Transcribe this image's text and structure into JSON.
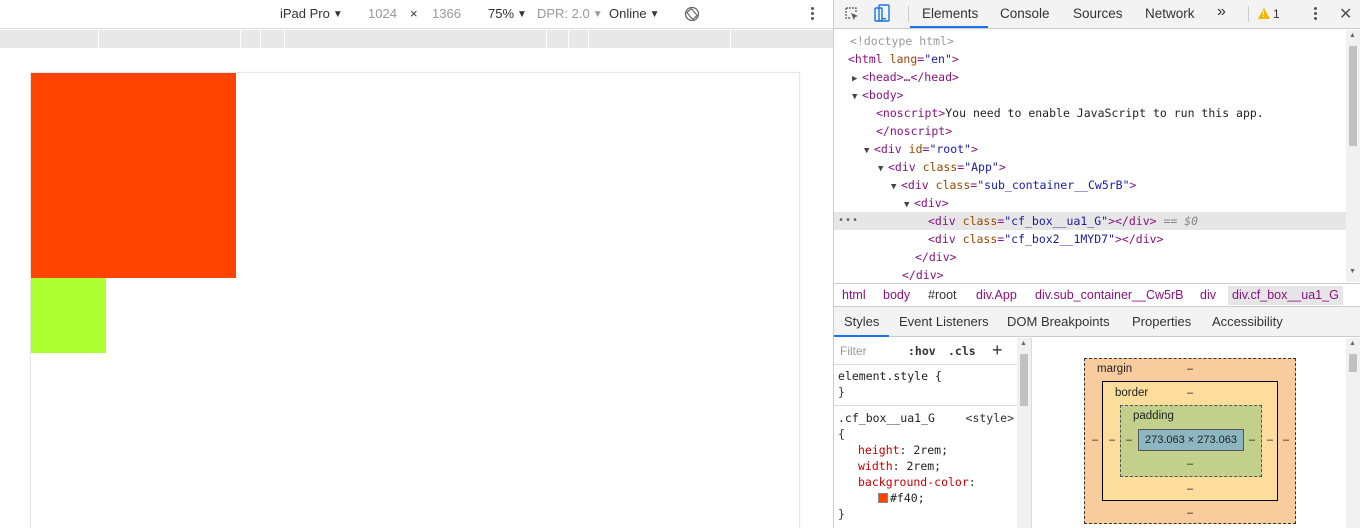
{
  "device_toolbar": {
    "device": "iPad Pro",
    "width": "1024",
    "times": "×",
    "height": "1366",
    "zoom": "75%",
    "dpr": "DPR: 2.0",
    "network": "Online",
    "rotate_icon": "rotate-icon",
    "more_icon": "kebab-menu-icon"
  },
  "preview": {
    "box1_color": "#ff4400",
    "box2_color": "#adff2f"
  },
  "devtools": {
    "tabs": [
      "Elements",
      "Console",
      "Sources",
      "Network"
    ],
    "more_tabs": "»",
    "warnings_count": "1",
    "close": "✕",
    "dom": {
      "doctype": "<!doctype html>",
      "html_open_tag": "<html",
      "html_lang_attr": "lang",
      "html_lang_val": "\"en\"",
      "head": "<head>…</head>",
      "body_open": "<body>",
      "noscript_open": "<noscript>",
      "noscript_text": "You need to enable JavaScript to run this app.",
      "noscript_close": "</noscript>",
      "div_root_tag": "<div",
      "id_attr": "id",
      "root_val": "\"root\"",
      "class_attr": "class",
      "app_val": "\"App\"",
      "sub_container_val": "\"sub_container__Cw5rB\"",
      "div_open": "<div>",
      "box_val": "\"cf_box__ua1_G\"",
      "box2_val": "\"cf_box2__1MYD7\"",
      "div_close": "</div>",
      "tag_end": ">",
      "eq_marker": "== $0",
      "selected_dots": "•••"
    },
    "breadcrumbs": [
      "html",
      "body",
      "#root",
      "div.App",
      "div.sub_container__Cw5rB",
      "div",
      "div.cf_box__ua1_G"
    ],
    "sub_tabs": [
      "Styles",
      "Event Listeners",
      "DOM Breakpoints",
      "Properties",
      "Accessibility"
    ],
    "styles": {
      "filter_placeholder": "Filter",
      "hov": ":hov",
      "cls": ".cls",
      "plus": "+",
      "element_style": "element.style {",
      "close_brace": "}",
      "rule_selector": ".cf_box__ua1_G",
      "rule_source": "<style>",
      "open_brace": "{",
      "props": [
        {
          "name": "height",
          "value": "2rem;"
        },
        {
          "name": "width",
          "value": "2rem;"
        },
        {
          "name": "background-color",
          "value": ""
        }
      ],
      "bg_color_value": "#f40;",
      "bg_swatch": "#ff4400"
    },
    "box_model": {
      "margin_label": "margin",
      "border_label": "border",
      "padding_label": "padding",
      "dash": "–",
      "content_size": "273.063 × 273.063"
    }
  }
}
